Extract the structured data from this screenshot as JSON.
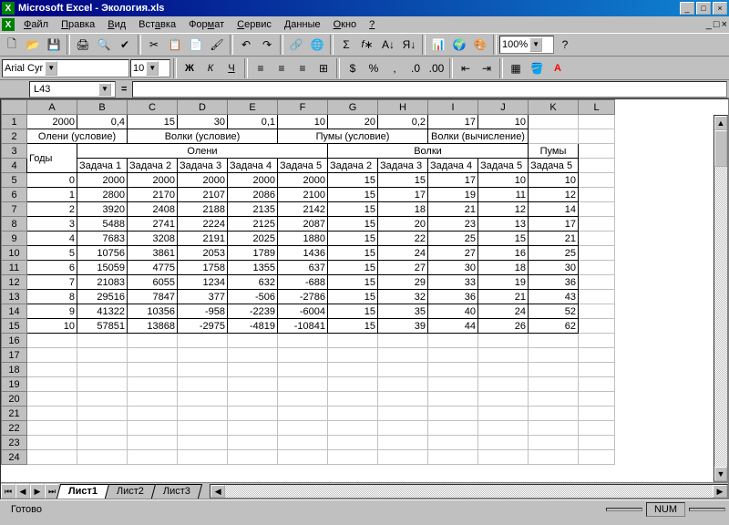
{
  "title": "Microsoft Excel - Экология.xls",
  "menu": {
    "file": "Файл",
    "edit": "Правка",
    "view": "Вид",
    "insert": "Вставка",
    "format": "Формат",
    "tools": "Сервис",
    "data": "Данные",
    "window": "Окно",
    "help": "?"
  },
  "zoom": "100%",
  "font": {
    "name": "Arial Cyr",
    "size": "10"
  },
  "namebox": "L43",
  "tabs": {
    "s1": "Лист1",
    "s2": "Лист2",
    "s3": "Лист3"
  },
  "status": {
    "ready": "Готово",
    "num": "NUM"
  },
  "cols": [
    "A",
    "B",
    "C",
    "D",
    "E",
    "F",
    "G",
    "H",
    "I",
    "J",
    "K",
    "L"
  ],
  "row1": {
    "A": "2000",
    "B": "0,4",
    "C": "15",
    "D": "30",
    "E": "0,1",
    "F": "10",
    "G": "20",
    "H": "0,2",
    "I": "17",
    "J": "10"
  },
  "row2": {
    "AB": "Олени (условие)",
    "CE": "Волки (условие)",
    "FH": "Пумы (условие)",
    "IJ": "Волки (вычисление)"
  },
  "row3": {
    "A": "Годы",
    "BF": "Олени",
    "GJ": "Волки",
    "K": "Пумы"
  },
  "row4": {
    "B": "Задача 1",
    "C": "Задача 2",
    "D": "Задача 3",
    "E": "Задача 4",
    "F": "Задача 5",
    "G": "Задача 2",
    "H": "Задача 3",
    "I": "Задача 4",
    "J": "Задача 5",
    "K": "Задача 5"
  },
  "data": [
    {
      "A": "0",
      "B": "2000",
      "C": "2000",
      "D": "2000",
      "E": "2000",
      "F": "2000",
      "G": "15",
      "H": "15",
      "I": "17",
      "J": "10",
      "K": "10"
    },
    {
      "A": "1",
      "B": "2800",
      "C": "2170",
      "D": "2107",
      "E": "2086",
      "F": "2100",
      "G": "15",
      "H": "17",
      "I": "19",
      "J": "11",
      "K": "12"
    },
    {
      "A": "2",
      "B": "3920",
      "C": "2408",
      "D": "2188",
      "E": "2135",
      "F": "2142",
      "G": "15",
      "H": "18",
      "I": "21",
      "J": "12",
      "K": "14"
    },
    {
      "A": "3",
      "B": "5488",
      "C": "2741",
      "D": "2224",
      "E": "2125",
      "F": "2087",
      "G": "15",
      "H": "20",
      "I": "23",
      "J": "13",
      "K": "17"
    },
    {
      "A": "4",
      "B": "7683",
      "C": "3208",
      "D": "2191",
      "E": "2025",
      "F": "1880",
      "G": "15",
      "H": "22",
      "I": "25",
      "J": "15",
      "K": "21"
    },
    {
      "A": "5",
      "B": "10756",
      "C": "3861",
      "D": "2053",
      "E": "1789",
      "F": "1436",
      "G": "15",
      "H": "24",
      "I": "27",
      "J": "16",
      "K": "25"
    },
    {
      "A": "6",
      "B": "15059",
      "C": "4775",
      "D": "1758",
      "E": "1355",
      "F": "637",
      "G": "15",
      "H": "27",
      "I": "30",
      "J": "18",
      "K": "30"
    },
    {
      "A": "7",
      "B": "21083",
      "C": "6055",
      "D": "1234",
      "E": "632",
      "F": "-688",
      "G": "15",
      "H": "29",
      "I": "33",
      "J": "19",
      "K": "36"
    },
    {
      "A": "8",
      "B": "29516",
      "C": "7847",
      "D": "377",
      "E": "-506",
      "F": "-2786",
      "G": "15",
      "H": "32",
      "I": "36",
      "J": "21",
      "K": "43"
    },
    {
      "A": "9",
      "B": "41322",
      "C": "10356",
      "D": "-958",
      "E": "-2239",
      "F": "-6004",
      "G": "15",
      "H": "35",
      "I": "40",
      "J": "24",
      "K": "52"
    },
    {
      "A": "10",
      "B": "57851",
      "C": "13868",
      "D": "-2975",
      "E": "-4819",
      "F": "-10841",
      "G": "15",
      "H": "39",
      "I": "44",
      "J": "26",
      "K": "62"
    }
  ]
}
